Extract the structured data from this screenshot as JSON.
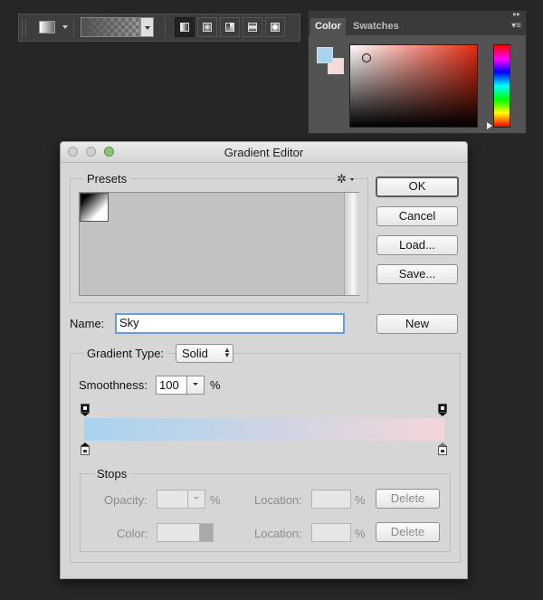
{
  "options_bar": {
    "tool_label": "Gradient tool",
    "gradient_types": [
      "Linear Gradient",
      "Radial Gradient",
      "Angle Gradient",
      "Reflected Gradient",
      "Diamond Gradient"
    ]
  },
  "color_panel": {
    "tabs": [
      "Color",
      "Swatches"
    ],
    "foreground_color": "#a9d4f0",
    "background_color": "#f4dada"
  },
  "dialog": {
    "title": "Gradient Editor",
    "presets_label": "Presets",
    "buttons": {
      "ok": "OK",
      "cancel": "Cancel",
      "load": "Load...",
      "save": "Save...",
      "new": "New"
    },
    "name_label": "Name:",
    "name_value": "Sky",
    "gradient_type_label": "Gradient Type:",
    "gradient_type_value": "Solid",
    "smoothness_label": "Smoothness:",
    "smoothness_value": "100",
    "percent": "%",
    "gradient_colors": {
      "start": "#a7d3ef",
      "end": "#f2d6d9"
    },
    "stops": {
      "label": "Stops",
      "opacity_label": "Opacity:",
      "color_label": "Color:",
      "location_label": "Location:",
      "delete_label": "Delete"
    }
  }
}
